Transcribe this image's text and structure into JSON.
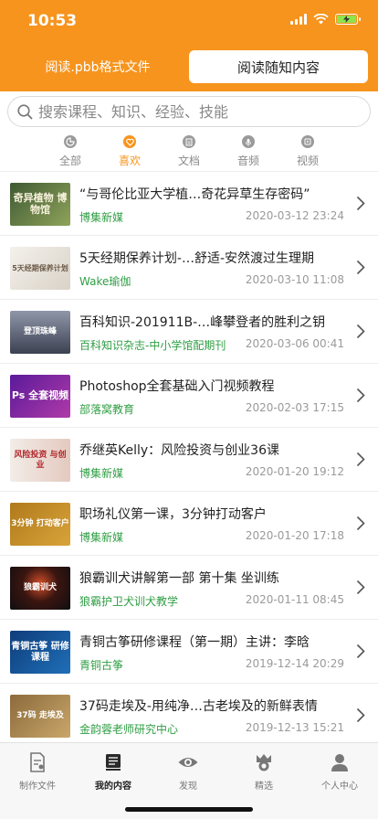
{
  "status": {
    "time": "10:53"
  },
  "colors": {
    "accent": "#f7941d",
    "author_green": "#2f9e44"
  },
  "segment": {
    "left_label": "阅读.pbb格式文件",
    "right_label": "阅读随知内容"
  },
  "search": {
    "placeholder": "搜索课程、知识、经验、技能",
    "icon": "search-icon"
  },
  "categories": [
    {
      "label": "全部",
      "icon": "all-icon",
      "active": false
    },
    {
      "label": "喜欢",
      "icon": "heart-icon",
      "active": true
    },
    {
      "label": "文档",
      "icon": "document-icon",
      "active": false
    },
    {
      "label": "音频",
      "icon": "microphone-icon",
      "active": false
    },
    {
      "label": "视频",
      "icon": "video-icon",
      "active": false
    }
  ],
  "items": [
    {
      "title": "“与哥伦比亚大学植…奇花异草生存密码”",
      "author": "博集新媒",
      "date": "2020-03-12 23:24",
      "thumb_text": "奇异植物 博物馆"
    },
    {
      "title": "5天经期保养计划-…舒适-安然渡过生理期",
      "author": "Wake瑜伽",
      "date": "2020-03-10 11:08",
      "thumb_text": "5天经期保养计划"
    },
    {
      "title": "百科知识-201911B-…峰攀登者的胜利之钥",
      "author": "百科知识杂志-中小学馆配期刊",
      "date": "2020-03-06 00:41",
      "thumb_text": "登顶珠峰"
    },
    {
      "title": "Photoshop全套基础入门视频教程",
      "author": "部落窝教育",
      "date": "2020-02-03 17:15",
      "thumb_text": "Ps 全套视频"
    },
    {
      "title": "乔继英Kelly：风险投资与创业36课",
      "author": "博集新媒",
      "date": "2020-01-20 19:12",
      "thumb_text": "风险投资 与创业"
    },
    {
      "title": "职场礼仪第一课，3分钟打动客户",
      "author": "博集新媒",
      "date": "2020-01-20 17:18",
      "thumb_text": "3分钟 打动客户"
    },
    {
      "title": "狼霸训犬讲解第一部 第十集  坐训练",
      "author": "狼霸护卫犬训犬教学",
      "date": "2020-01-11 08:45",
      "thumb_text": "狼霸训犬"
    },
    {
      "title": "青铜古筝研修课程（第一期）主讲：李晗",
      "author": "青铜古筝",
      "date": "2019-12-14 20:29",
      "thumb_text": "青铜古筝 研修课程"
    },
    {
      "title": "37码走埃及-用纯净…古老埃及的新鲜表情",
      "author": "金韵蓉老师研究中心",
      "date": "2019-12-13 15:21",
      "thumb_text": "37码 走埃及"
    }
  ],
  "tabbar": [
    {
      "label": "制作文件",
      "icon": "make-file-icon",
      "active": false
    },
    {
      "label": "我的内容",
      "icon": "my-content-icon",
      "active": true
    },
    {
      "label": "发现",
      "icon": "discover-eye-icon",
      "active": false
    },
    {
      "label": "精选",
      "icon": "featured-icon",
      "active": false
    },
    {
      "label": "个人中心",
      "icon": "person-icon",
      "active": false
    }
  ]
}
